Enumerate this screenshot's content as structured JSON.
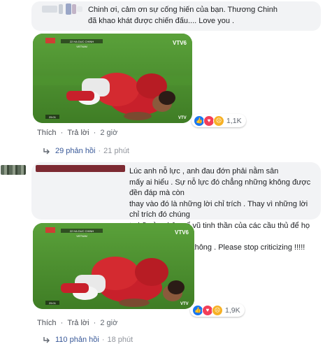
{
  "comment1": {
    "text": "Chinh ơi, cảm ơn sự cống hiến của bạn. Thương Chinh\nđã khao khát được chiến đấu.... Love you .",
    "actions": {
      "like": "Thích",
      "reply": "Trả lời",
      "time": "2 giờ"
    },
    "reactions": {
      "count": "1,1K",
      "types": [
        "like-icon",
        "love-icon",
        "sad-icon"
      ]
    },
    "replies": {
      "label": "29 phản hồi",
      "time": "21 phút"
    },
    "photo": {
      "channel_logo": "VTV6",
      "corner_logo": "VTV",
      "score_label": "22 HA DUC CHINH",
      "sub_label": "VIETNAM",
      "clock": "25:01"
    }
  },
  "comment2": {
    "text": "Lúc anh nỗ lực , anh đau đớn phải nằm sân\nmấy ai hiểu . Sự nỗ lực đó chẳng những không được đền đáp mà còn\nthay vào đó là những lời chỉ trích . Thay vì những lời chỉ trích đó chúng\nta hãy ủng hộ , cổ vũ tinh thần của các cầu thủ để họ được tiếp thêm\nsức mạnh cố nên không . Please stop criticizing !!!!!",
    "actions": {
      "like": "Thích",
      "reply": "Trả lời",
      "time": "2 giờ"
    },
    "reactions": {
      "count": "1,9K",
      "types": [
        "like-icon",
        "love-icon",
        "sad-icon"
      ]
    },
    "replies": {
      "label": "110 phản hồi",
      "time": "18 phút"
    },
    "photo": {
      "channel_logo": "VTV6",
      "corner_logo": "VTV",
      "score_label": "22 HA DUC CHINH",
      "sub_label": "VIETNAM",
      "clock": "25:01"
    }
  },
  "separator": "·",
  "colors": {
    "bubble": "#f2f3f5",
    "link": "#385898",
    "like": "#1877f2",
    "love": "#f33e58",
    "sad": "#f7b125"
  }
}
